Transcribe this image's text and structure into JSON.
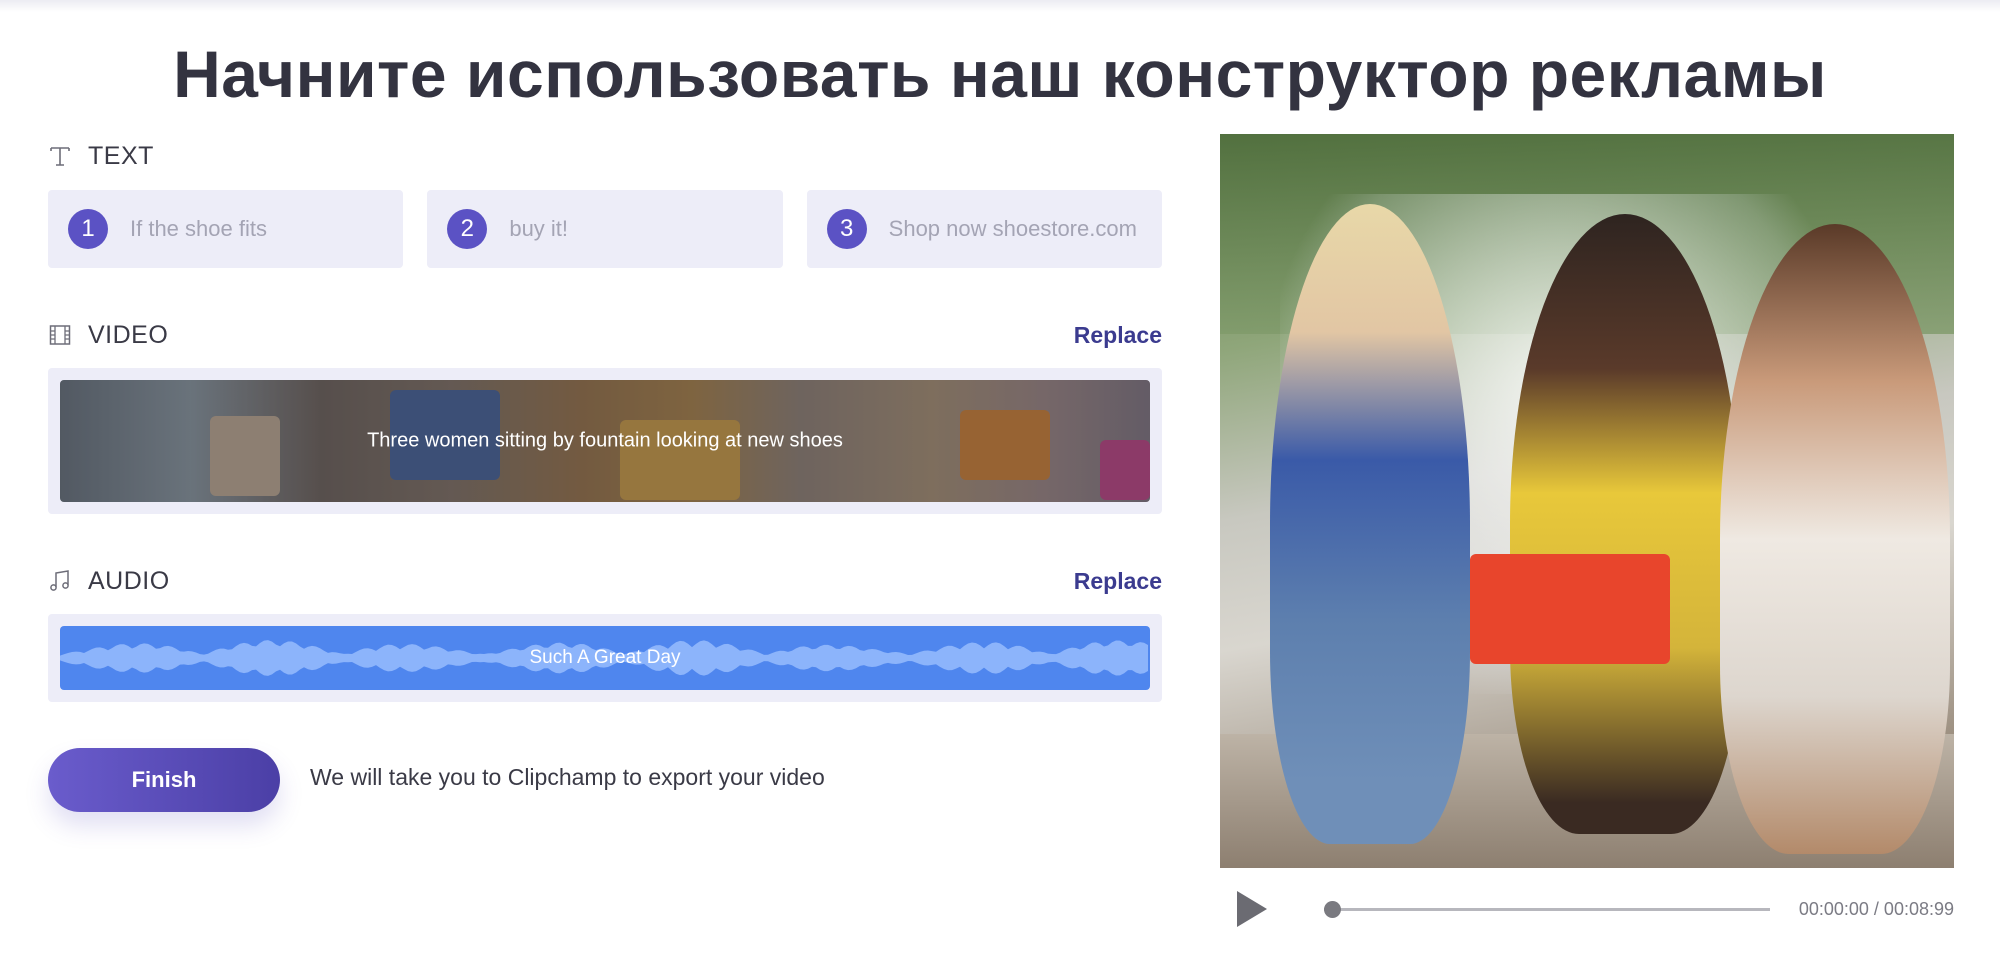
{
  "page": {
    "title": "Начните использовать наш конструктор рекламы"
  },
  "text_section": {
    "label": "TEXT",
    "icon": "text-icon",
    "fields": [
      {
        "number": "1",
        "value": "If the shoe fits"
      },
      {
        "number": "2",
        "value": "buy it!"
      },
      {
        "number": "3",
        "value": "Shop now shoestore.com"
      }
    ]
  },
  "video_section": {
    "label": "VIDEO",
    "icon": "film-icon",
    "replace_label": "Replace",
    "clip_caption": "Three women sitting by fountain looking at new shoes"
  },
  "audio_section": {
    "label": "AUDIO",
    "icon": "music-note-icon",
    "replace_label": "Replace",
    "track_caption": "Such A Great Day"
  },
  "actions": {
    "finish_label": "Finish",
    "finish_note": "We will take you to Clipchamp to export your video"
  },
  "player": {
    "time": "00:00:00 / 00:08:99",
    "progress": 0
  },
  "colors": {
    "accent": "#5b52c4",
    "audio_track": "#4f86ee",
    "field_bg": "#ededf8",
    "link": "#3b3b8f"
  }
}
